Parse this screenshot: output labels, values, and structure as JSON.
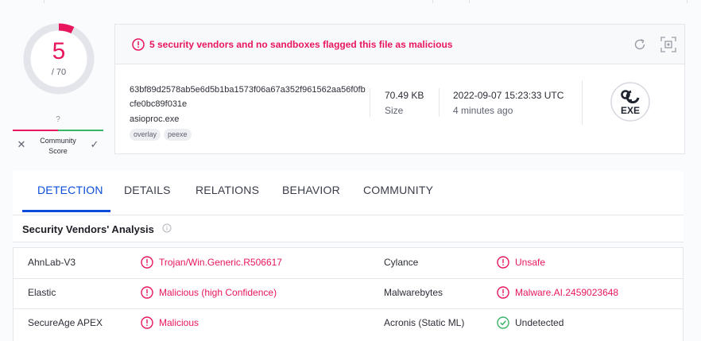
{
  "score": {
    "detections": "5",
    "total": "/ 70"
  },
  "community": {
    "value": "?",
    "label": "Community Score"
  },
  "alert": {
    "message": "5 security vendors and no sandboxes flagged this file as malicious"
  },
  "file": {
    "hash": "63bf89d2578ab5e6d5b1ba1573f06a67a352f961562aa56f0fbcfe0bc89f031e",
    "name": "asioproc.exe",
    "tags": [
      "overlay",
      "peexe"
    ],
    "size": "70.49 KB",
    "size_label": "Size",
    "date": "2022-09-07 15:23:33 UTC",
    "date_relative": "4 minutes ago",
    "type_icon_text": "EXE"
  },
  "tabs": [
    "DETECTION",
    "DETAILS",
    "RELATIONS",
    "BEHAVIOR",
    "COMMUNITY"
  ],
  "active_tab": "DETECTION",
  "section": {
    "title": "Security Vendors' Analysis"
  },
  "detections": [
    {
      "vendor": "AhnLab-V3",
      "result": "Trojan/Win.Generic.R506617",
      "status": "malicious"
    },
    {
      "vendor": "Cylance",
      "result": "Unsafe",
      "status": "malicious"
    },
    {
      "vendor": "Elastic",
      "result": "Malicious (high Confidence)",
      "status": "malicious"
    },
    {
      "vendor": "Malwarebytes",
      "result": "Malware.AI.2459023648",
      "status": "malicious"
    },
    {
      "vendor": "SecureAge APEX",
      "result": "Malicious",
      "status": "malicious"
    },
    {
      "vendor": "Acronis (Static ML)",
      "result": "Undetected",
      "status": "undetected"
    }
  ],
  "colors": {
    "malicious": "#e8175d",
    "undetected": "#3ab567",
    "accent": "#0b4dda"
  }
}
